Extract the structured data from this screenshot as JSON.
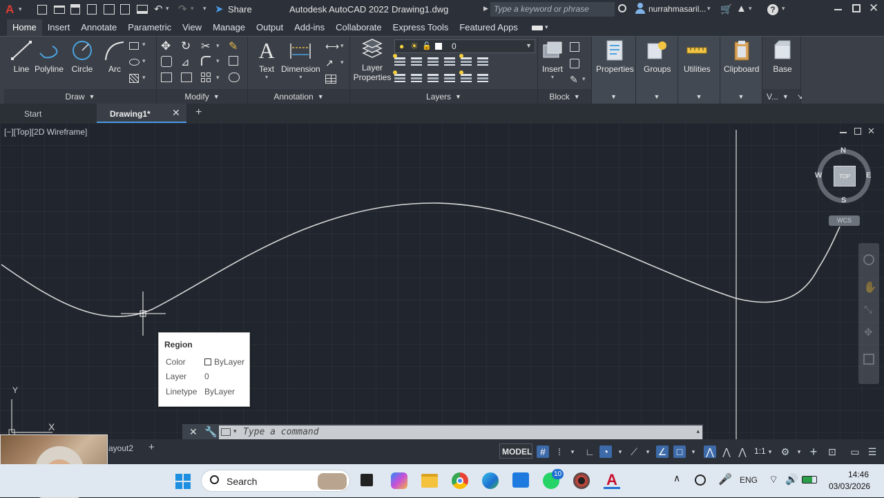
{
  "titlebar": {
    "app_title": "Autodesk AutoCAD 2022",
    "file_name": "Drawing1.dwg",
    "search_placeholder": "Type a keyword or phrase",
    "user_name": "nurrahmasaril...",
    "share_label": "Share"
  },
  "menu_tabs": [
    "Home",
    "Insert",
    "Annotate",
    "Parametric",
    "View",
    "Manage",
    "Output",
    "Add-ins",
    "Collaborate",
    "Express Tools",
    "Featured Apps"
  ],
  "ribbon": {
    "draw": {
      "line": "Line",
      "polyline": "Polyline",
      "circle": "Circle",
      "arc": "Arc",
      "title": "Draw"
    },
    "modify": {
      "title": "Modify"
    },
    "annotation": {
      "text": "Text",
      "dimension": "Dimension",
      "title": "Annotation"
    },
    "layers": {
      "layer_properties_line1": "Layer",
      "layer_properties_line2": "Properties",
      "current_layer": "0",
      "title": "Layers"
    },
    "block": {
      "insert": "Insert",
      "title": "Block"
    },
    "properties": "Properties",
    "groups": "Groups",
    "utilities": "Utilities",
    "clipboard": "Clipboard",
    "base": "Base",
    "view_short": "V..."
  },
  "doc_tabs": {
    "start": "Start",
    "drawing": "Drawing1*"
  },
  "viewport": {
    "label": "[−][Top][2D Wireframe]",
    "viewcube": {
      "n": "N",
      "s": "S",
      "e": "E",
      "w": "W",
      "top": "TOP",
      "wcs": "WCS"
    },
    "ucs_y": "Y",
    "ucs_x": "X"
  },
  "tooltip": {
    "title": "Region",
    "rows": [
      {
        "key": "Color",
        "value": "ByLayer"
      },
      {
        "key": "Layer",
        "value": "0"
      },
      {
        "key": "Linetype",
        "value": "ByLayer"
      }
    ]
  },
  "command_line": {
    "placeholder": "Type a command"
  },
  "layout_tab": "ayout2",
  "status": {
    "model": "MODEL",
    "scale": "1:1"
  },
  "taskbar": {
    "search": "Search",
    "lang": "ENG",
    "time": "14:46",
    "date": "03/03/2026",
    "whatsapp_badge": "10"
  },
  "colors": {
    "accent": "#3d6aa8",
    "canvas": "#21262e",
    "ribbon": "#3b4048",
    "acad_red": "#c8102e"
  }
}
